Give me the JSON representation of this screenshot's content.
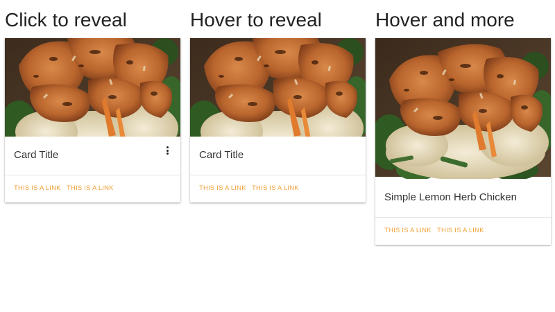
{
  "sections": [
    {
      "heading": "Click to reveal",
      "card": {
        "title": "Card Title",
        "image_alt": "grilled chicken on rice with spinach",
        "has_more_icon": true,
        "links": [
          "This is a link",
          "This is a link"
        ]
      }
    },
    {
      "heading": "Hover to reveal",
      "card": {
        "title": "Card Title",
        "image_alt": "grilled chicken on rice with spinach",
        "has_more_icon": false,
        "links": [
          "This is a link",
          "This is a link"
        ]
      }
    },
    {
      "heading": "Hover and more",
      "card": {
        "title": "Simple Lemon Herb Chicken",
        "image_alt": "grilled chicken on rice with spinach",
        "has_more_icon": false,
        "links": [
          "This is a link",
          "This is a link"
        ]
      }
    }
  ],
  "icons": {
    "more": "more-vert-icon"
  },
  "colors": {
    "link": "#f0a23a",
    "heading": "#222222"
  }
}
